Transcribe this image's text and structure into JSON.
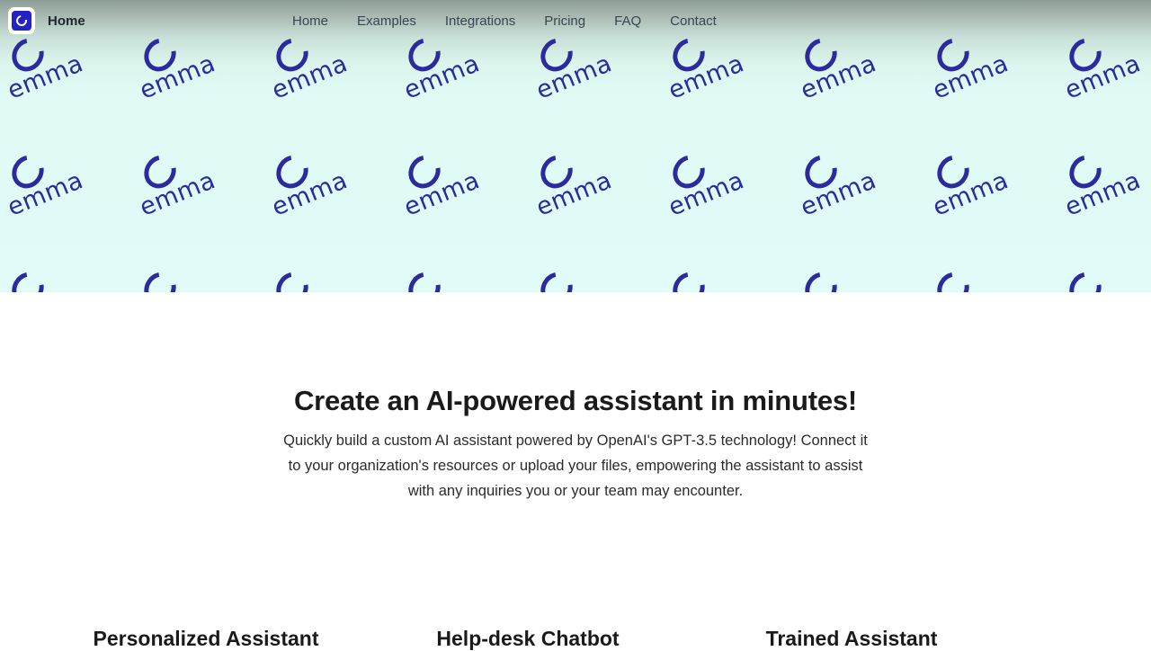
{
  "browser": {
    "tab_title": "Home",
    "favicon_icon": "emma-ring-icon"
  },
  "nav": {
    "items": [
      {
        "label": "Home"
      },
      {
        "label": "Examples"
      },
      {
        "label": "Integrations"
      },
      {
        "label": "Pricing"
      },
      {
        "label": "FAQ"
      },
      {
        "label": "Contact"
      }
    ]
  },
  "banner": {
    "watermark_word": "emma",
    "ring_icon": "emma-ring-icon",
    "gradient_top_color": "#8d9d95",
    "gradient_bottom_color": "#e0fbf8",
    "brand_color": "#2b2b9e"
  },
  "hero": {
    "heading": "Create an AI-powered assistant in minutes!",
    "subtext": "Quickly build a custom AI assistant powered by OpenAI's GPT-3.5 technology! Connect it to your organization's resources or upload your files, empowering the assistant to assist with any inquiries you or your team may encounter."
  },
  "features": [
    {
      "title": "Personalized Assistant"
    },
    {
      "title": "Help-desk Chatbot"
    },
    {
      "title": "Trained Assistant"
    }
  ]
}
